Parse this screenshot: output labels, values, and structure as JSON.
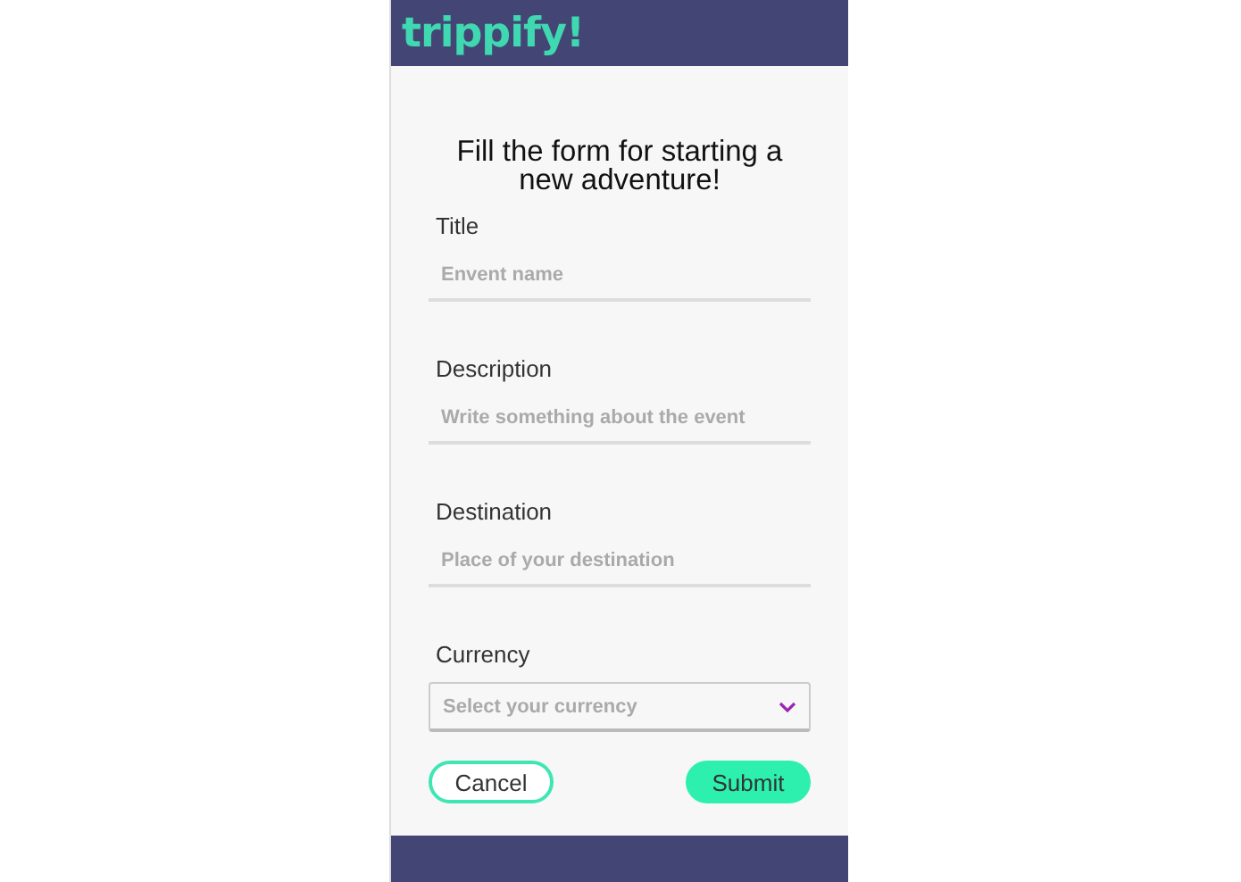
{
  "header": {
    "logo": "trippify!"
  },
  "form": {
    "heading": "Fill the form for starting a new adventure!",
    "fields": [
      {
        "kind": "text",
        "label": "Title",
        "placeholder": "Envent name"
      },
      {
        "kind": "text",
        "label": "Description",
        "placeholder": "Write something about the event"
      },
      {
        "kind": "text",
        "label": "Destination",
        "placeholder": "Place of your destination"
      },
      {
        "kind": "select",
        "label": "Currency",
        "placeholder": "Select your currency"
      }
    ],
    "buttons": [
      {
        "kind": "outline",
        "label": "Cancel"
      },
      {
        "kind": "filled",
        "label": "Submit"
      }
    ]
  }
}
